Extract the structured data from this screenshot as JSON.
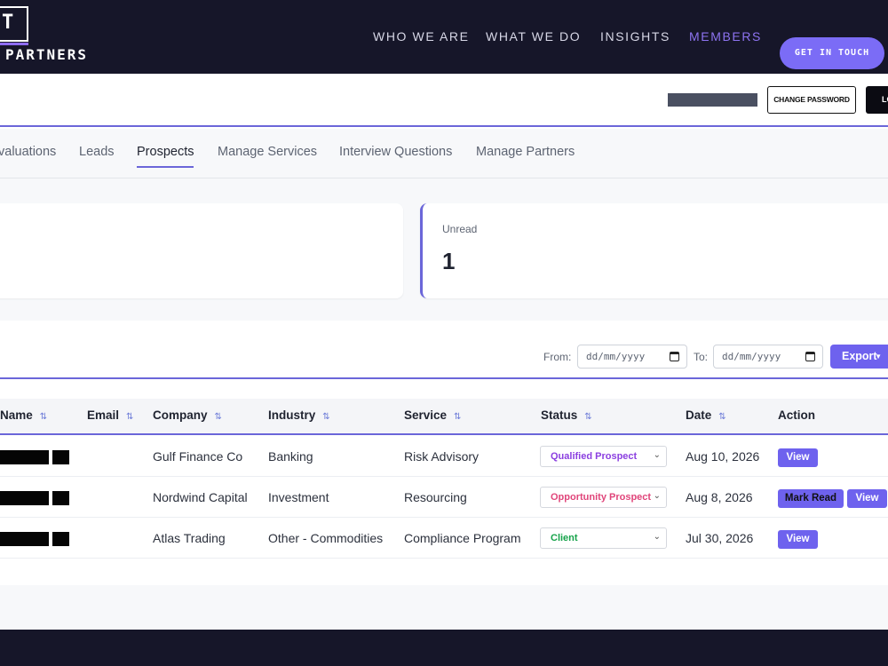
{
  "header": {
    "logo_mark": "T",
    "logo_text": "PARTNERS",
    "nav": [
      "WHO WE ARE",
      "WHAT WE DO",
      "INSIGHTS",
      "MEMBERS"
    ],
    "active_nav": "MEMBERS",
    "cta_label": "GET IN TOUCH"
  },
  "userbar": {
    "change_password_label": "CHANGE PASSWORD",
    "logout_label_partial": "LO"
  },
  "tabs": [
    "valuations",
    "Leads",
    "Prospects",
    "Manage Services",
    "Interview Questions",
    "Manage Partners"
  ],
  "active_tab": "Prospects",
  "cards": {
    "unread_label": "Unread",
    "unread_value": "1"
  },
  "filters": {
    "from_label": "From:",
    "from_placeholder": "dd/mm/yyyy",
    "to_label": "To:",
    "to_placeholder": "dd/mm/yyyy",
    "export_label": "Export"
  },
  "table": {
    "columns": [
      "Name",
      "Email",
      "Company",
      "Industry",
      "Service",
      "Status",
      "Date",
      "Action"
    ],
    "sort_icon": "⇅",
    "rows": [
      {
        "company": "Gulf Finance Co",
        "industry": "Banking",
        "service": "Risk Advisory",
        "status": "Qualified Prospect",
        "status_color": "#8b3fe0",
        "date": "Aug 10, 2026",
        "actions": [
          "View"
        ]
      },
      {
        "company": "Nordwind Capital",
        "industry": "Investment",
        "service": "Resourcing",
        "status": "Opportunity Prospect",
        "status_color": "#e0457a",
        "date": "Aug 8, 2026",
        "actions": [
          "Mark Read",
          "View"
        ]
      },
      {
        "company": "Atlas Trading",
        "industry": "Other - Commodities",
        "service": "Compliance Program",
        "status": "Client",
        "status_color": "#16a34a",
        "date": "Jul 30, 2026",
        "actions": [
          "View"
        ]
      }
    ]
  },
  "colors": {
    "header_bg": "#161629",
    "accent": "#6b66d9",
    "button": "#6e62ee",
    "nav_active": "#8d73f0"
  }
}
